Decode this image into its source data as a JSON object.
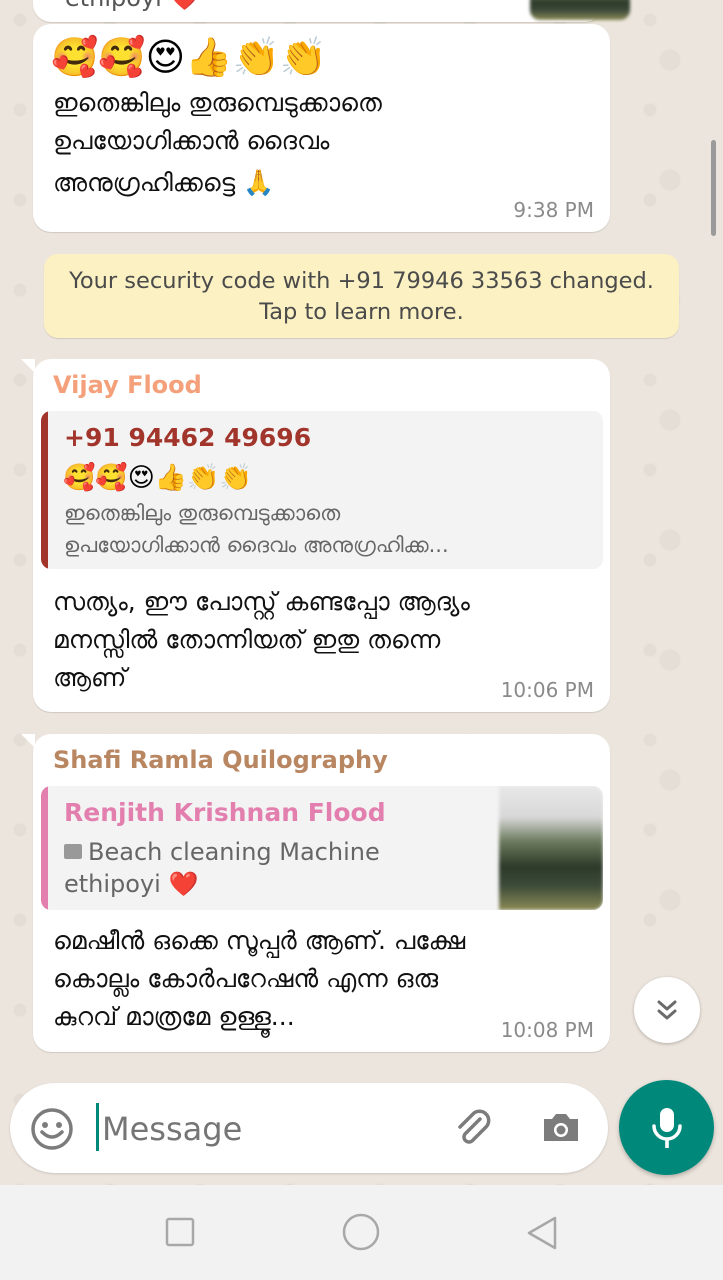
{
  "messages": [
    {
      "emoji": "🥰🥰😍👍👏👏",
      "lines": [
        "ഇതെങ്കിലും തുരുമ്പെടുക്കാതെ",
        "ഉപയോഗിക്കാൻ ദൈവം",
        "അനുഗ്രഹിക്കട്ടെ 🙏"
      ],
      "time": "9:38 PM",
      "top_partial_text": "ethipoyi ❤️"
    },
    {
      "sender": "Vijay Flood",
      "sender_color": "#f4a07a",
      "quote": {
        "name": "+91 94462 49696",
        "name_color": "#a2352b",
        "emoji": "🥰🥰😍👍👏👏",
        "lines": [
          "ഇതെങ്കിലും തുരുമ്പെടുക്കാതെ",
          "ഉപയോഗിക്കാൻ ദൈവം അനുഗ്രഹിക്ക..."
        ]
      },
      "lines": [
        "സത്യം, ഈ പോസ്റ്റ് കണ്ടപ്പോ ആദ്യം",
        "മനസ്സിൽ തോന്നിയത് ഇതു തന്നെ",
        "ആണ്"
      ],
      "time": "10:06 PM"
    },
    {
      "sender": "Shafi Ramla Quilography",
      "sender_color": "#b98662",
      "quote": {
        "name": "Renjith Krishnan Flood",
        "name_color": "#e37fae",
        "photo_label": "Beach cleaning Machine",
        "line2": "ethipoyi ❤️"
      },
      "lines": [
        "മെഷീൻ ഒക്കെ സൂപ്പർ ആണ്. പക്ഷേ",
        "കൊല്ലം കോർപറേഷൻ എന്ന ഒരു",
        "കുറവ് മാത്രമേ ഉള്ളൂ..."
      ],
      "time": "10:08 PM"
    }
  ],
  "system_notice": {
    "line1": "Your security code with +91 79946 33563 changed.",
    "line2": "Tap to learn more."
  },
  "composer": {
    "placeholder": "Message"
  },
  "colors": {
    "accent": "#00897b",
    "system_bg": "#fbf1c3"
  }
}
